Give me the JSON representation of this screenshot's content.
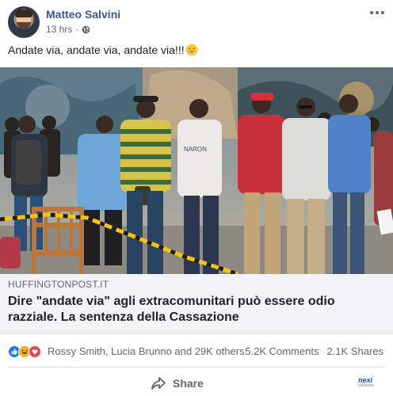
{
  "post": {
    "author": "Matteo Salvini",
    "time": "13 hrs",
    "privacy_icon": "globe-icon",
    "message": "Andate via, andate via, andate via!!!",
    "message_emoji": "grinning-face-emoji"
  },
  "link": {
    "domain": "HUFFINGTONPOST.IT",
    "title": "Dire \"andate via\" agli extracomunitari può essere odio razziale. La sentenza della Cassazione",
    "shirt_text": "NARON"
  },
  "reactions": {
    "icons": [
      "like-icon",
      "haha-icon",
      "love-icon"
    ],
    "names": "Rossy Smith, Lucia Brunno and 29K others",
    "comments": "5.2K Comments",
    "shares": "2.1K Shares"
  },
  "actions": {
    "share_label": "Share",
    "badge_text": "nexi",
    "badge_subtext": "solutions"
  },
  "colors": {
    "author": "#385898",
    "like": "#1877f2",
    "haha": "#f7b125",
    "love": "#f33e58",
    "link_box_bg": "#f2f3f5"
  }
}
